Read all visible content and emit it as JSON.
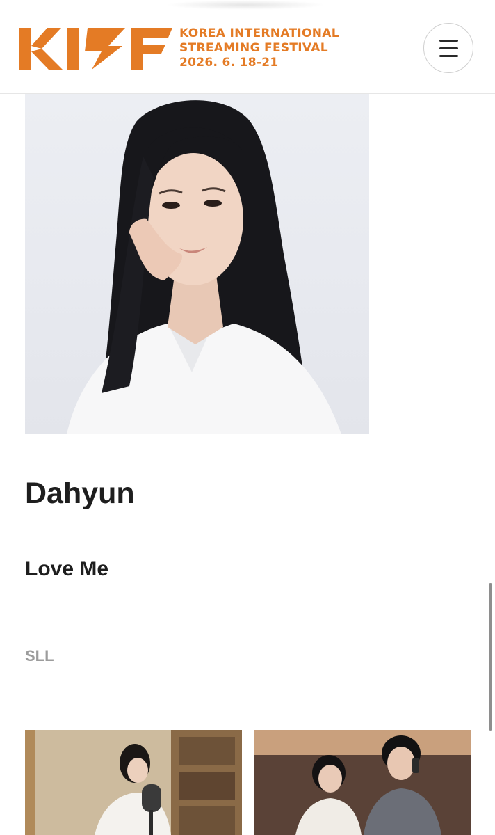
{
  "header": {
    "logo": {
      "mark": "KISF",
      "line1": "KOREA INTERNATIONAL",
      "line2": "STREAMING FESTIVAL",
      "line3": "2026. 6. 18-21"
    },
    "menu_icon": "hamburger-menu-icon"
  },
  "profile": {
    "name": "Dahyun",
    "work_title": "Love Me",
    "distributor": "SLL"
  },
  "colors": {
    "brand_orange": "#e47b25",
    "heading": "#1e1e1e",
    "muted": "#9c9c9c",
    "background": "#ffffff"
  }
}
